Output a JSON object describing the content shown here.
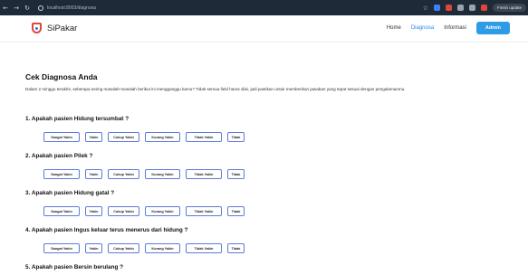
{
  "browser": {
    "url": "localhost:8003/diagnosa",
    "update_label": "Finish update"
  },
  "navbar": {
    "brand": "SiPakar",
    "links": [
      "Home",
      "Diagnosa",
      "Informasi"
    ],
    "admin_label": "Admin",
    "accent": "#2d9be6"
  },
  "page": {
    "title": "Cek Diagnosa Anda",
    "description": "Dalam 2 minggu terakhir, seberapa sering masalah-masalah berikut ini mengganggu kamu? Tidak semua field harus diisi, jadi pastikan untuk memberikan jawaban yang tepat sesuai dengan pengalamanmu."
  },
  "options": [
    "Sangat Yakin",
    "Yakin",
    "Cukup Yakin",
    "Kurang Yakin",
    "Tidak Yakin",
    "Tidak"
  ],
  "questions": [
    "1. Apakah pasien Hidung tersumbat ?",
    "2. Apakah pasien Pilek ?",
    "3. Apakah pasien Hidung gatal ?",
    "4. Apakah pasien Ingus keluar terus menerus dari hidung ?",
    "5. Apakah pasien Bersin berulang ?"
  ]
}
